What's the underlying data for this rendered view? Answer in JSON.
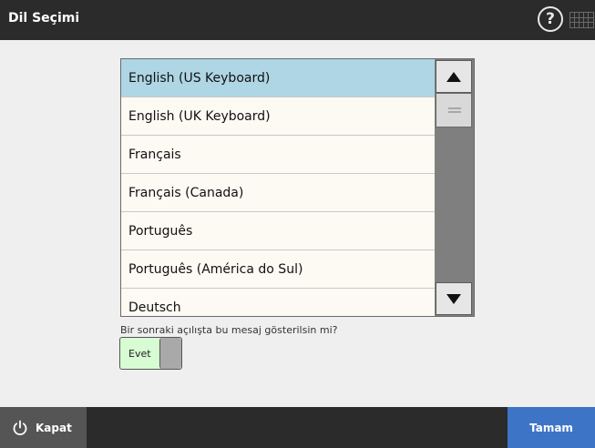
{
  "header": {
    "title": "Dil Seçimi",
    "help_icon": "help-icon",
    "keyboard_icon": "keyboard-icon"
  },
  "language_list": {
    "selected": "English (US Keyboard)",
    "items": [
      "English (US Keyboard)",
      "English (UK Keyboard)",
      "Français",
      "Français (Canada)",
      "Português",
      "Português (América do Sul)",
      "Deutsch"
    ]
  },
  "options": {
    "prompt": "Bir sonraki açılışta bu mesaj gösterilsin mi?",
    "toggle_label": "Evet",
    "toggle_on": true
  },
  "footer": {
    "close_label": "Kapat",
    "close_icon": "power-icon",
    "ok_label": "Tamam"
  },
  "colors": {
    "header_bg": "#2b2b2b",
    "selected_row": "#aed6e4",
    "toggle_on": "#d7fbd2",
    "ok_button": "#3e74c6"
  }
}
